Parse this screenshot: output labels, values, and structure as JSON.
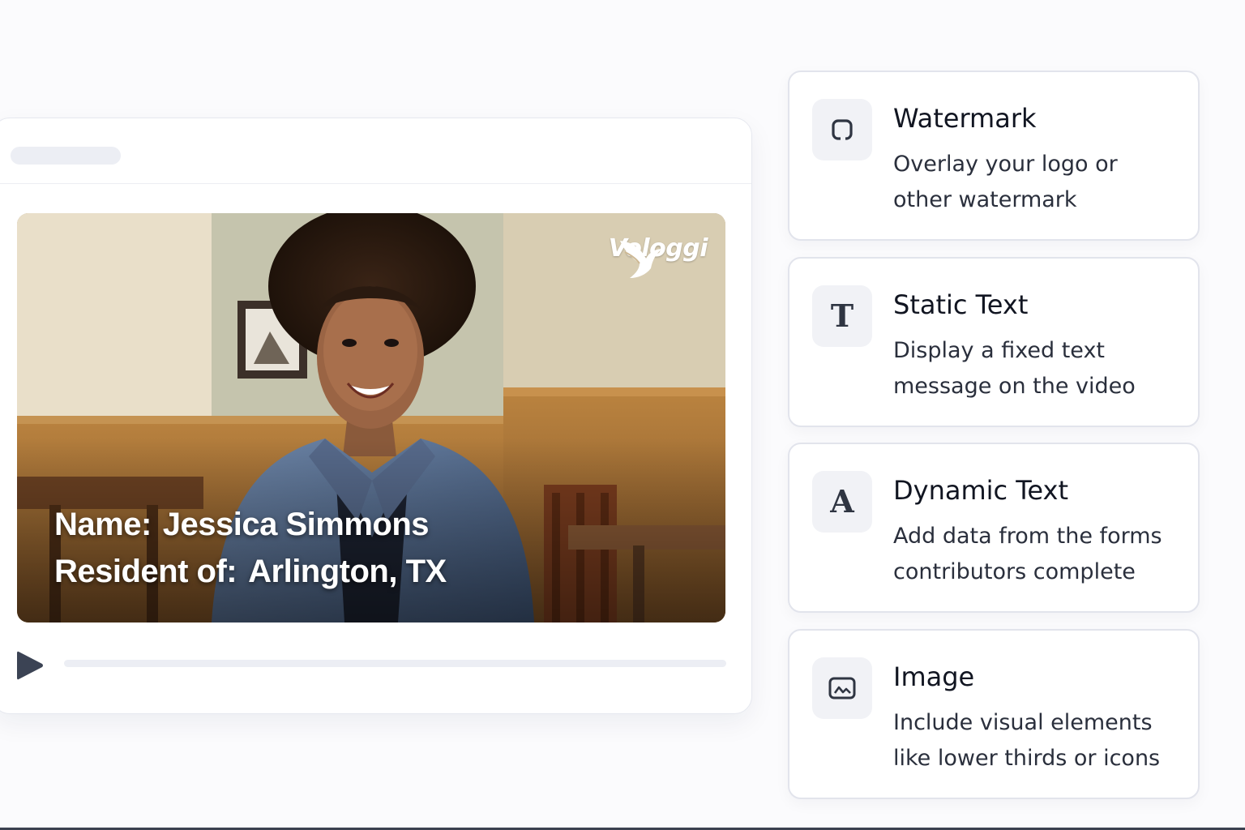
{
  "video": {
    "brand": "Vologgi",
    "lower_third": {
      "name_label": "Name:",
      "name_value": "Jessica Simmons",
      "resident_label": "Resident of:",
      "resident_value": "Arlington, TX"
    },
    "progress": 0
  },
  "features": [
    {
      "icon": "watermark-icon",
      "title": "Watermark",
      "desc1": "Overlay your logo or",
      "desc2": "other watermark"
    },
    {
      "icon": "text-t-icon",
      "glyph": "T",
      "title": "Static Text",
      "desc1": "Display a fixed text",
      "desc2": "message on the video"
    },
    {
      "icon": "text-a-icon",
      "glyph": "A",
      "title": "Dynamic Text",
      "desc1": "Add data from the forms",
      "desc2": "contributors complete"
    },
    {
      "icon": "image-icon",
      "title": "Image",
      "desc1": "Include visual elements",
      "desc2": "like lower thirds or icons"
    }
  ],
  "colors": {
    "accent_dark": "#3b4354",
    "card_border": "#e2e4ec",
    "icon_bg": "#f1f2f6"
  }
}
